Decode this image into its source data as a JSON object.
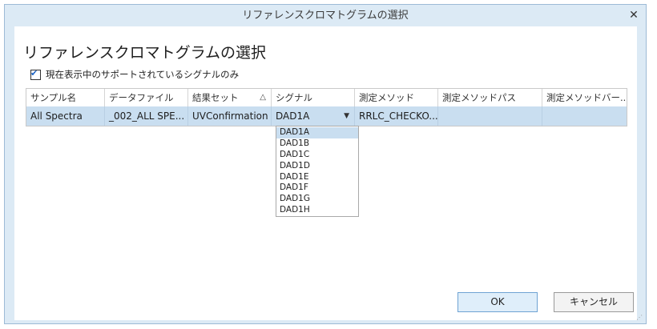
{
  "window": {
    "title": "リファレンスクロマトグラムの選択",
    "close_glyph": "✕"
  },
  "heading": "リファレンスクロマトグラムの選択",
  "filter": {
    "checked": true,
    "label": "現在表示中のサポートされているシグナルのみ"
  },
  "table": {
    "columns": [
      "サンプル名",
      "データファイル",
      "結果セット",
      "シグナル",
      "測定メソッド",
      "測定メソッドパス",
      "測定メソッドバー..."
    ],
    "sorted_column": "結果セット",
    "sort_icon": "△",
    "rows": [
      [
        "All Spectra",
        "_002_ALL SPE...",
        "UVConfirmation",
        "DAD1A",
        "RRLC_CHECKO...",
        "",
        ""
      ]
    ]
  },
  "signal_dropdown": {
    "selected": "DAD1A",
    "arrow": "▼",
    "options": [
      "DAD1A",
      "DAD1B",
      "DAD1C",
      "DAD1D",
      "DAD1E",
      "DAD1F",
      "DAD1G",
      "DAD1H"
    ]
  },
  "buttons": {
    "ok": "OK",
    "cancel": "キャンセル"
  },
  "colors": {
    "accent": "#1b63c4",
    "selection": "#c9def0",
    "frame": "#dceaf5"
  }
}
